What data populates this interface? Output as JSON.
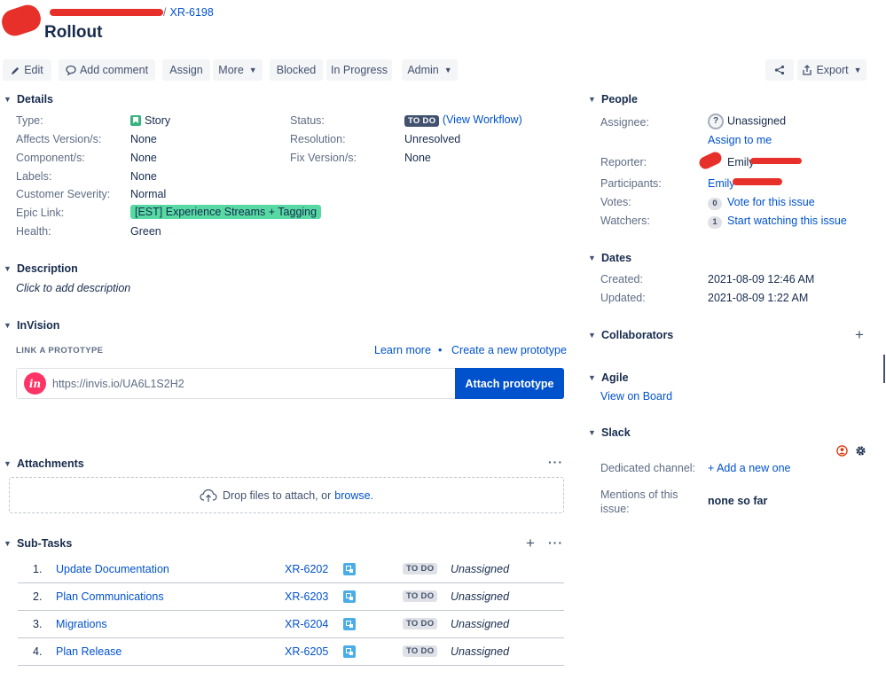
{
  "header": {
    "breadcrumb_project": "",
    "breadcrumb_issue": "XR-6198",
    "title": "Rollout"
  },
  "toolbar": {
    "edit": "Edit",
    "add_comment": "Add comment",
    "assign": "Assign",
    "more": "More",
    "blocked": "Blocked",
    "in_progress": "In Progress",
    "admin": "Admin",
    "export": "Export"
  },
  "details": {
    "heading": "Details",
    "type_label": "Type:",
    "type_value": "Story",
    "affects_label": "Affects Version/s:",
    "affects_value": "None",
    "component_label": "Component/s:",
    "component_value": "None",
    "labels_label": "Labels:",
    "labels_value": "None",
    "severity_label": "Customer Severity:",
    "severity_value": "Normal",
    "epic_label": "Epic Link:",
    "epic_value": "[EST] Experience Streams + Tagging",
    "health_label": "Health:",
    "health_value": "Green",
    "status_label": "Status:",
    "status_badge": "TO DO",
    "status_link": "(View Workflow)",
    "resolution_label": "Resolution:",
    "resolution_value": "Unresolved",
    "fix_label": "Fix Version/s:",
    "fix_value": "None"
  },
  "description": {
    "heading": "Description",
    "placeholder": "Click to add description"
  },
  "invision": {
    "heading": "InVision",
    "link_label": "LINK A PROTOTYPE",
    "learn_more": "Learn more",
    "bullet": "•",
    "create": "Create a new prototype",
    "logo": "in",
    "url_placeholder": "https://invis.io/UA6L1S2H2",
    "attach": "Attach prototype"
  },
  "attachments": {
    "heading": "Attachments",
    "more": "···",
    "drop_text": "Drop files to attach, or",
    "browse": "browse."
  },
  "subtasks": {
    "heading": "Sub-Tasks",
    "add": "+",
    "more": "···",
    "rows": [
      {
        "num": "1.",
        "name": "Update Documentation",
        "key": "XR-6202",
        "status": "TO DO",
        "assignee": "Unassigned"
      },
      {
        "num": "2.",
        "name": "Plan Communications",
        "key": "XR-6203",
        "status": "TO DO",
        "assignee": "Unassigned"
      },
      {
        "num": "3.",
        "name": "Migrations",
        "key": "XR-6204",
        "status": "TO DO",
        "assignee": "Unassigned"
      },
      {
        "num": "4.",
        "name": "Plan Release",
        "key": "XR-6205",
        "status": "TO DO",
        "assignee": "Unassigned"
      }
    ]
  },
  "people": {
    "heading": "People",
    "assignee_label": "Assignee:",
    "assignee_value": "Unassigned",
    "assign_me": "Assign to me",
    "reporter_label": "Reporter:",
    "reporter_value": "Emily",
    "participants_label": "Participants:",
    "participants_value": "Emily",
    "votes_label": "Votes:",
    "votes_count": "0",
    "vote_link": "Vote for this issue",
    "watchers_label": "Watchers:",
    "watchers_count": "1",
    "watch_link": "Start watching this issue"
  },
  "dates": {
    "heading": "Dates",
    "created_label": "Created:",
    "created_value": "2021-08-09 12:46 AM",
    "updated_label": "Updated:",
    "updated_value": "2021-08-09 1:22 AM"
  },
  "collaborators": {
    "heading": "Collaborators",
    "add": "+"
  },
  "agile": {
    "heading": "Agile",
    "view_board": "View on Board"
  },
  "slack": {
    "heading": "Slack",
    "channel_label": "Dedicated channel:",
    "channel_link": "+ Add a new one",
    "mentions_label_1": "Mentions of this",
    "mentions_label_2": "issue:",
    "mentions_value": "none so far"
  },
  "colors": {
    "accent": "#0052cc",
    "todo_badge": "#42526e",
    "epic": "#57d9a3",
    "story": "#36b37e",
    "redaction": "#e8302a"
  }
}
